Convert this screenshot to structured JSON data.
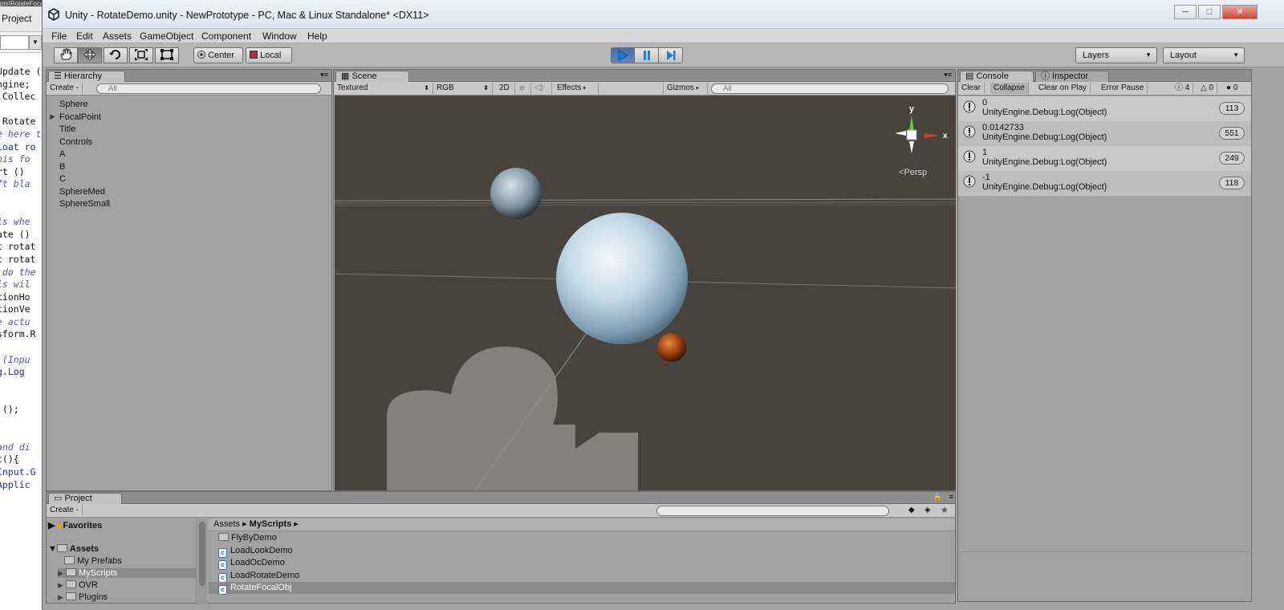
{
  "bg_editor": {
    "title_fragment": "pts\\RotateFocalObj.cs - MonoDevelop-Unity",
    "tab_label": "Project",
    "code_lines": [
      {
        "text": "Update ()",
        "style": "plain"
      },
      {
        "text": "ngine;",
        "style": "plain"
      },
      {
        "text": ".Collec",
        "style": "plain"
      },
      {
        "text": "",
        "style": "plain"
      },
      {
        "text": " Rotate",
        "style": "plain"
      },
      {
        "text": "e here t",
        "style": "cm"
      },
      {
        "text": "loat ro",
        "style": "kw"
      },
      {
        "text": "his fo",
        "style": "cm"
      },
      {
        "text": "rt () ",
        "style": "plain"
      },
      {
        "text": "ft bla",
        "style": "cm"
      },
      {
        "text": "",
        "style": "plain"
      },
      {
        "text": "",
        "style": "plain"
      },
      {
        "text": "is whe",
        "style": "cm"
      },
      {
        "text": "ate ()",
        "style": "plain"
      },
      {
        "text": "t rotat",
        "style": "plain"
      },
      {
        "text": "t rotat",
        "style": "plain"
      },
      {
        "text": " do the",
        "style": "cm"
      },
      {
        "text": "is wil",
        "style": "cm"
      },
      {
        "text": "tionHo",
        "style": "plain"
      },
      {
        "text": "tionVe",
        "style": "plain"
      },
      {
        "text": "e actu",
        "style": "cm"
      },
      {
        "text": "sform.R",
        "style": "plain"
      },
      {
        "text": "",
        "style": "plain"
      },
      {
        "text": " (Inpu",
        "style": "cm"
      },
      {
        "text": "g.Log",
        "style": "kw"
      },
      {
        "text": "",
        "style": "plain"
      },
      {
        "text": "",
        "style": "plain"
      },
      {
        "text": " ();",
        "style": "plain"
      },
      {
        "text": "",
        "style": "plain"
      },
      {
        "text": "",
        "style": "plain"
      },
      {
        "text": "and di",
        "style": "cm"
      },
      {
        "text": "t(){",
        "style": "plain"
      },
      {
        "text": "Input.G",
        "style": "kw"
      },
      {
        "text": "Applic",
        "style": "kw"
      }
    ]
  },
  "window": {
    "title": "Unity - RotateDemo.unity - NewPrototype - PC, Mac & Linux Standalone* <DX11>",
    "minimize": "─",
    "maximize": "□",
    "close": "✕"
  },
  "menu": [
    "File",
    "Edit",
    "Assets",
    "GameObject",
    "Component",
    "Window",
    "Help"
  ],
  "toolbar": {
    "tools": [
      "hand-icon",
      "move-icon",
      "rotate-icon",
      "scale-icon",
      "rect-icon"
    ],
    "pivot_label": "Center",
    "space_label": "Local",
    "layers_label": "Layers",
    "layout_label": "Layout"
  },
  "hierarchy": {
    "tab_label": "Hierarchy",
    "create_label": "Create -",
    "search_placeholder": "All",
    "items": [
      {
        "label": "Sphere",
        "expandable": false
      },
      {
        "label": "FocalPoint",
        "expandable": true
      },
      {
        "label": "Title",
        "expandable": false
      },
      {
        "label": "Controls",
        "expandable": false
      },
      {
        "label": "A",
        "expandable": false
      },
      {
        "label": "B",
        "expandable": false
      },
      {
        "label": "C",
        "expandable": false
      },
      {
        "label": "SphereMed",
        "expandable": false
      },
      {
        "label": "SphereSmall",
        "expandable": false
      }
    ]
  },
  "scene": {
    "tab_label": "Scene",
    "shading_mode": "Textured",
    "render_mode": "RGB",
    "mode_2d": "2D",
    "effects_label": "Effects",
    "gizmos_label": "Gizmos",
    "search_placeholder": "All",
    "gizmo_y": "y",
    "gizmo_x": "x",
    "projection_label": "Persp"
  },
  "console": {
    "tab_label": "Console",
    "inspector_tab_label": "Inspector",
    "buttons": [
      "Clear",
      "Collapse",
      "Clear on Play",
      "Error Pause"
    ],
    "log_count": "4",
    "warning_count": "0",
    "error_count": "0",
    "entries": [
      {
        "value": "0",
        "source": "UnityEngine.Debug:Log(Object)",
        "count": "113"
      },
      {
        "value": "0.0142733",
        "source": "UnityEngine.Debug:Log(Object)",
        "count": "551"
      },
      {
        "value": "1",
        "source": "UnityEngine.Debug:Log(Object)",
        "count": "249"
      },
      {
        "value": "-1",
        "source": "UnityEngine.Debug:Log(Object)",
        "count": "118"
      }
    ]
  },
  "project": {
    "tab_label": "Project",
    "create_label": "Create -",
    "favorites_label": "Favorites",
    "assets_label": "Assets",
    "tree": [
      "My Prefabs",
      "MyScripts",
      "OVR",
      "Plugins"
    ],
    "breadcrumb": [
      "Assets",
      "MyScripts"
    ],
    "files": [
      {
        "label": "FlyByDemo",
        "kind": "folder"
      },
      {
        "label": "LoadLookDemo",
        "kind": "script"
      },
      {
        "label": "LoadOcDemo",
        "kind": "script"
      },
      {
        "label": "LoadRotateDemo",
        "kind": "script"
      },
      {
        "label": "RotateFocalObj",
        "kind": "script",
        "selected": true
      }
    ]
  },
  "colors": {
    "panel_bg": "#a2a2a2",
    "scene_bg": "#474440",
    "play_active": "#4b6e9e",
    "gizmo_y": "#6fc93a",
    "gizmo_x": "#d23a2a"
  }
}
